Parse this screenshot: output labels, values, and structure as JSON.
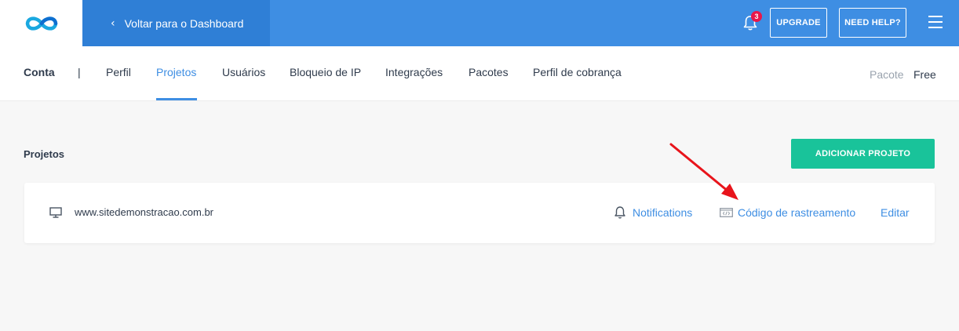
{
  "header": {
    "back_label": "Voltar para o Dashboard",
    "notification_count": "3",
    "upgrade_label": "UPGRADE",
    "help_label": "NEED HELP?"
  },
  "tabs": {
    "conta": "Conta",
    "separator": "|",
    "items": [
      {
        "label": "Perfil"
      },
      {
        "label": "Projetos"
      },
      {
        "label": "Usuários"
      },
      {
        "label": "Bloqueio de IP"
      },
      {
        "label": "Integrações"
      },
      {
        "label": "Pacotes"
      },
      {
        "label": "Perfil de cobrança"
      }
    ],
    "pacote_label": "Pacote",
    "pacote_value": "Free"
  },
  "main": {
    "title": "Projetos",
    "add_button": "ADICIONAR PROJETO",
    "project": {
      "site": "www.sitedemonstracao.com.br",
      "notifications": "Notifications",
      "tracking": "Código de rastreamento",
      "edit": "Editar"
    }
  },
  "colors": {
    "brand_blue": "#3e8ee3",
    "dark_blue": "#2f7fd6",
    "green": "#19c39a",
    "badge_red": "#e8174a",
    "annotation_arrow": "#e8141b"
  }
}
